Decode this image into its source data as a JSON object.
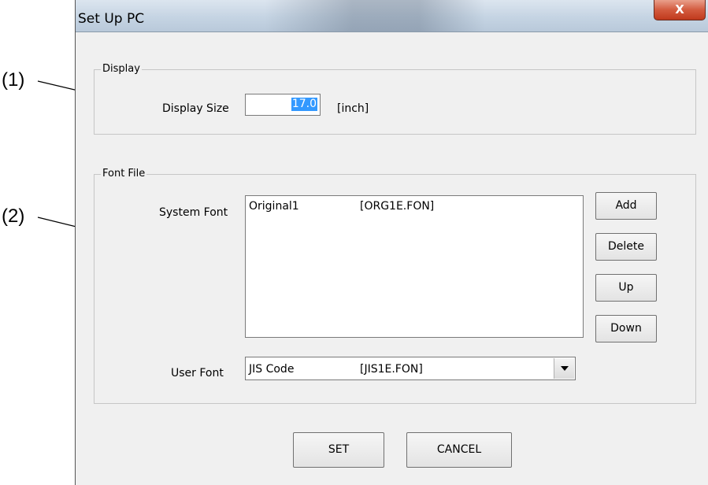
{
  "annotations": {
    "callout_1": "(1)",
    "callout_2": "(2)"
  },
  "window": {
    "title": "Set Up PC",
    "close_glyph": "X",
    "icons": {
      "close": "close-icon",
      "dropdown": "chevron-down-icon"
    }
  },
  "display_group": {
    "title": "Display",
    "size_label": "Display Size",
    "size_value": "17.0",
    "unit_label": "[inch]"
  },
  "font_group": {
    "title": "Font File",
    "system_font_label": "System Font",
    "system_fonts": [
      {
        "name": "Original1",
        "file": "[ORG1E.FON]"
      }
    ],
    "buttons": {
      "add": "Add",
      "delete": "Delete",
      "up": "Up",
      "down": "Down"
    },
    "user_font_label": "User Font",
    "user_font": {
      "name": "JIS Code",
      "file": "[JIS1E.FON]"
    }
  },
  "footer": {
    "set": "SET",
    "cancel": "CANCEL"
  },
  "colors": {
    "selection": "#3399ff",
    "close_button": "#c7432a",
    "dialog_background": "#f0f0f0"
  }
}
